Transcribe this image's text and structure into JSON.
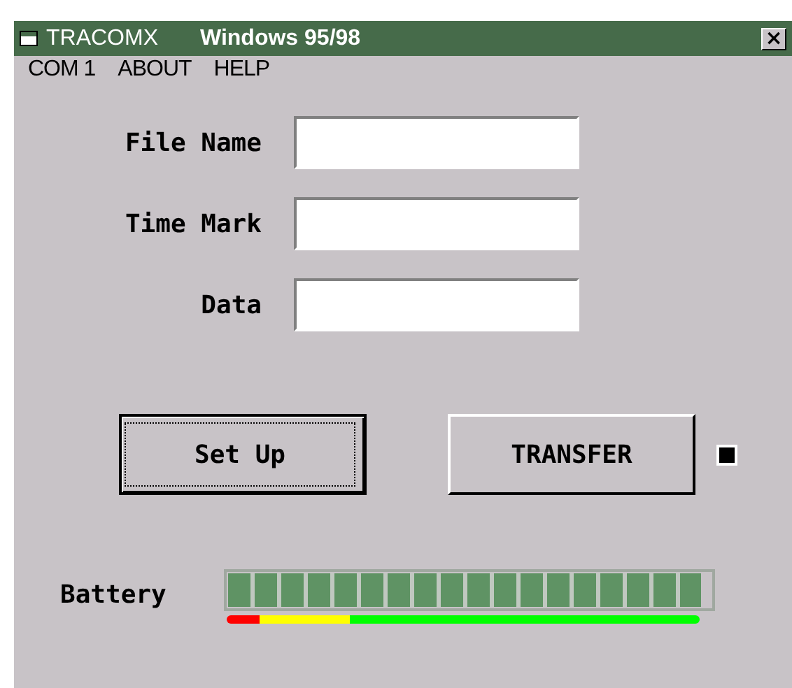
{
  "window": {
    "title": "TRACOMX",
    "subtitle": "Windows 95/98",
    "close": "×"
  },
  "menu": [
    "COM 1",
    "ABOUT",
    "HELP"
  ],
  "fields": [
    {
      "label": "File Name"
    },
    {
      "label": "Time Mark"
    },
    {
      "label": "Data"
    }
  ],
  "buttons": [
    {
      "label": "Set Up",
      "focused": true
    },
    {
      "label": "TRANSFER",
      "focused": false
    }
  ],
  "indicator": {
    "on": true
  },
  "battery": {
    "label": "Battery",
    "level": 0.98
  }
}
